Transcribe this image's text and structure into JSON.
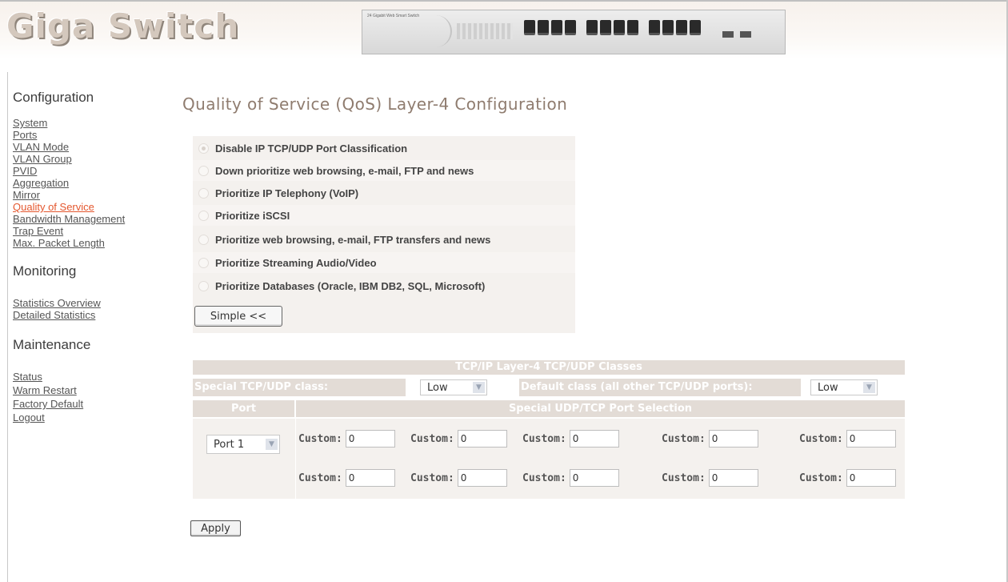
{
  "header": {
    "logo": "Giga Switch",
    "device_image_label": "24 Gigabit Web Smart Switch"
  },
  "sidebar": {
    "configuration": {
      "heading": "Configuration",
      "items": [
        "System",
        "Ports",
        "VLAN Mode",
        "VLAN Group",
        "PVID",
        "Aggregation",
        "Mirror",
        "Quality of Service",
        "Bandwidth Management",
        "Trap Event",
        "Max. Packet Length"
      ],
      "active": "Quality of Service"
    },
    "monitoring": {
      "heading": "Monitoring",
      "items": [
        "Statistics Overview",
        "Detailed Statistics"
      ]
    },
    "maintenance": {
      "heading": "Maintenance",
      "items": [
        "Status",
        "Warm Restart",
        "Factory Default",
        "Logout"
      ]
    }
  },
  "main": {
    "title": "Quality of Service (QoS) Layer-4 Configuration",
    "options": [
      "Disable IP TCP/UDP Port Classification",
      "Down prioritize web browsing, e-mail, FTP and news",
      "Prioritize IP Telephony (VoIP)",
      "Prioritize iSCSI",
      "Prioritize web browsing, e-mail, FTP transfers and news",
      "Prioritize Streaming Audio/Video",
      "Prioritize Databases (Oracle, IBM DB2, SQL, Microsoft)"
    ],
    "selected_option": "Disable IP TCP/UDP Port Classification",
    "simple_button": "Simple <<",
    "table": {
      "title": "TCP/IP Layer-4 TCP/UDP Classes",
      "special_class_label": "Special TCP/UDP class:",
      "special_class_value": "Low",
      "default_class_label": "Default class (all other TCP/UDP ports):",
      "default_class_value": "Low",
      "port_header": "Port",
      "selection_header": "Special UDP/TCP Port Selection",
      "port_value": "Port 1",
      "custom_label": "Custom:",
      "custom_values": [
        "0",
        "0",
        "0",
        "0",
        "0",
        "0",
        "0",
        "0",
        "0",
        "0"
      ]
    },
    "apply_button": "Apply"
  },
  "colors": {
    "active_link": "#e4572e",
    "table_header_bg": "#e3dcd6",
    "title_color": "#8f7c6f",
    "panel_bg": "#f4f1ee"
  }
}
